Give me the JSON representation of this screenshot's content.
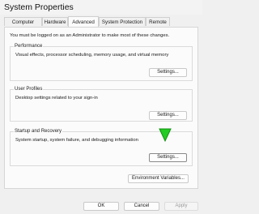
{
  "window": {
    "title": "System Properties"
  },
  "tabs": [
    {
      "label": "Computer Name",
      "active": false
    },
    {
      "label": "Hardware",
      "active": false
    },
    {
      "label": "Advanced",
      "active": true
    },
    {
      "label": "System Protection",
      "active": false
    },
    {
      "label": "Remote",
      "active": false
    }
  ],
  "notice": "You must be logged on as an Administrator to make most of these changes.",
  "groups": {
    "performance": {
      "title": "Performance",
      "description": "Visual effects, processor scheduling, memory usage, and virtual memory",
      "button": "Settings..."
    },
    "user_profiles": {
      "title": "User Profiles",
      "description": "Desktop settings related to your sign-in",
      "button": "Settings..."
    },
    "startup_recovery": {
      "title": "Startup and Recovery",
      "description": "System startup, system failure, and debugging information",
      "button": "Settings..."
    }
  },
  "environment_button": "Environment Variables...",
  "footer": {
    "ok": "OK",
    "cancel": "Cancel",
    "apply": "Apply"
  },
  "colors": {
    "annotation_arrow": "#22cc22",
    "focus_border": "#8a8a8a"
  }
}
